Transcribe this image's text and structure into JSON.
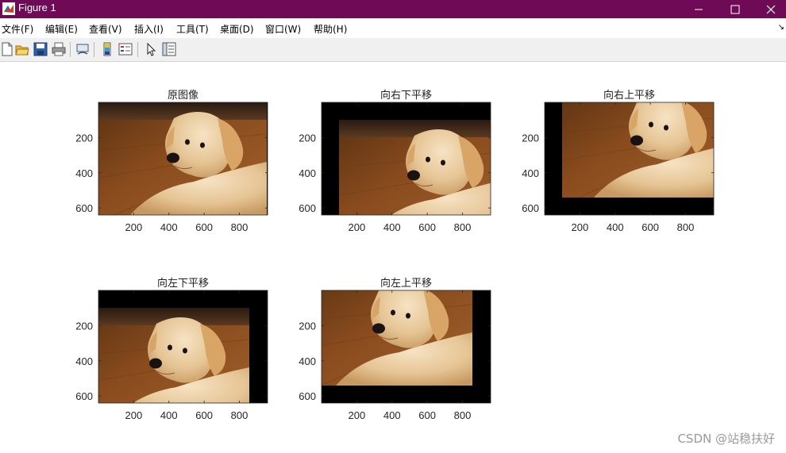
{
  "window": {
    "title": "Figure 1",
    "title_bar_color": "#6f0a57",
    "icons": [
      "matlab-logo-icon",
      "minimize-icon",
      "maximize-icon",
      "close-icon"
    ]
  },
  "menu": {
    "items": [
      "文件(F)",
      "编辑(E)",
      "查看(V)",
      "插入(I)",
      "工具(T)",
      "桌面(D)",
      "窗口(W)",
      "帮助(H)"
    ],
    "overflow_arrow": "↘"
  },
  "toolbar": {
    "buttons": [
      "new-figure-icon",
      "open-file-icon",
      "save-icon",
      "print-icon",
      "link-plot-icon",
      "colorbar-icon",
      "legend-icon",
      "edit-plot-arrow-icon",
      "property-inspector-icon"
    ]
  },
  "chart_data": [
    {
      "type": "image",
      "title": "原图像",
      "shift": "none",
      "xticks": [
        "200",
        "400",
        "600",
        "800"
      ],
      "yticks": [
        "200",
        "400",
        "600"
      ]
    },
    {
      "type": "image",
      "title": "向右下平移",
      "shift": "right-down",
      "xticks": [
        "200",
        "400",
        "600",
        "800"
      ],
      "yticks": [
        "200",
        "400",
        "600"
      ]
    },
    {
      "type": "image",
      "title": "向右上平移",
      "shift": "right-up",
      "xticks": [
        "200",
        "400",
        "600",
        "800"
      ],
      "yticks": [
        "200",
        "400",
        "600"
      ]
    },
    {
      "type": "image",
      "title": "向左下平移",
      "shift": "left-down",
      "xticks": [
        "200",
        "400",
        "600",
        "800"
      ],
      "yticks": [
        "200",
        "400",
        "600"
      ]
    },
    {
      "type": "image",
      "title": "向左上平移",
      "shift": "left-up",
      "xticks": [
        "200",
        "400",
        "600",
        "800"
      ],
      "yticks": [
        "200",
        "400",
        "600"
      ]
    }
  ],
  "watermark": "CSDN @站稳扶好"
}
